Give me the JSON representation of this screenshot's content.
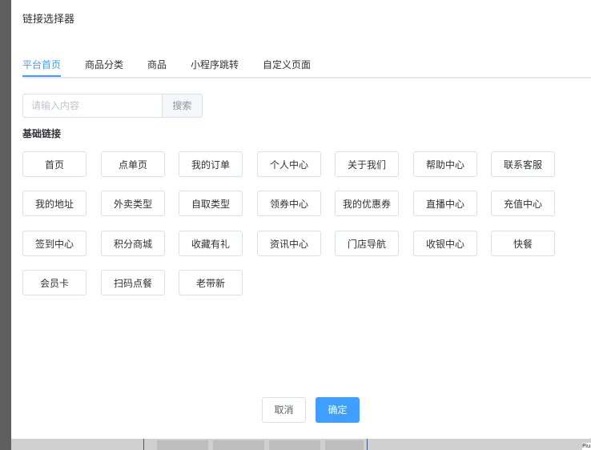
{
  "dialog": {
    "title": "链接选择器"
  },
  "tabs": [
    {
      "label": "平台首页",
      "active": true
    },
    {
      "label": "商品分类",
      "active": false
    },
    {
      "label": "商品",
      "active": false
    },
    {
      "label": "小程序跳转",
      "active": false
    },
    {
      "label": "自定义页面",
      "active": false
    }
  ],
  "search": {
    "placeholder": "请输入内容",
    "value": "",
    "button_label": "搜索"
  },
  "section": {
    "heading": "基础链接"
  },
  "links": [
    "首页",
    "点单页",
    "我的订单",
    "个人中心",
    "关于我们",
    "帮助中心",
    "联系客服",
    "我的地址",
    "外卖类型",
    "自取类型",
    "领券中心",
    "我的优惠券",
    "直播中心",
    "充值中心",
    "签到中心",
    "积分商城",
    "收藏有礼",
    "资讯中心",
    "门店导航",
    "收银中心",
    "快餐",
    "会员卡",
    "扫码点餐",
    "老带新"
  ],
  "footer": {
    "cancel_label": "取消",
    "confirm_label": "确定"
  },
  "background": {
    "partial_text": "Piu"
  },
  "colors": {
    "accent": "#409eff",
    "border": "#dcdfe6",
    "text": "#303133",
    "overlay": "#5f5f5f"
  }
}
